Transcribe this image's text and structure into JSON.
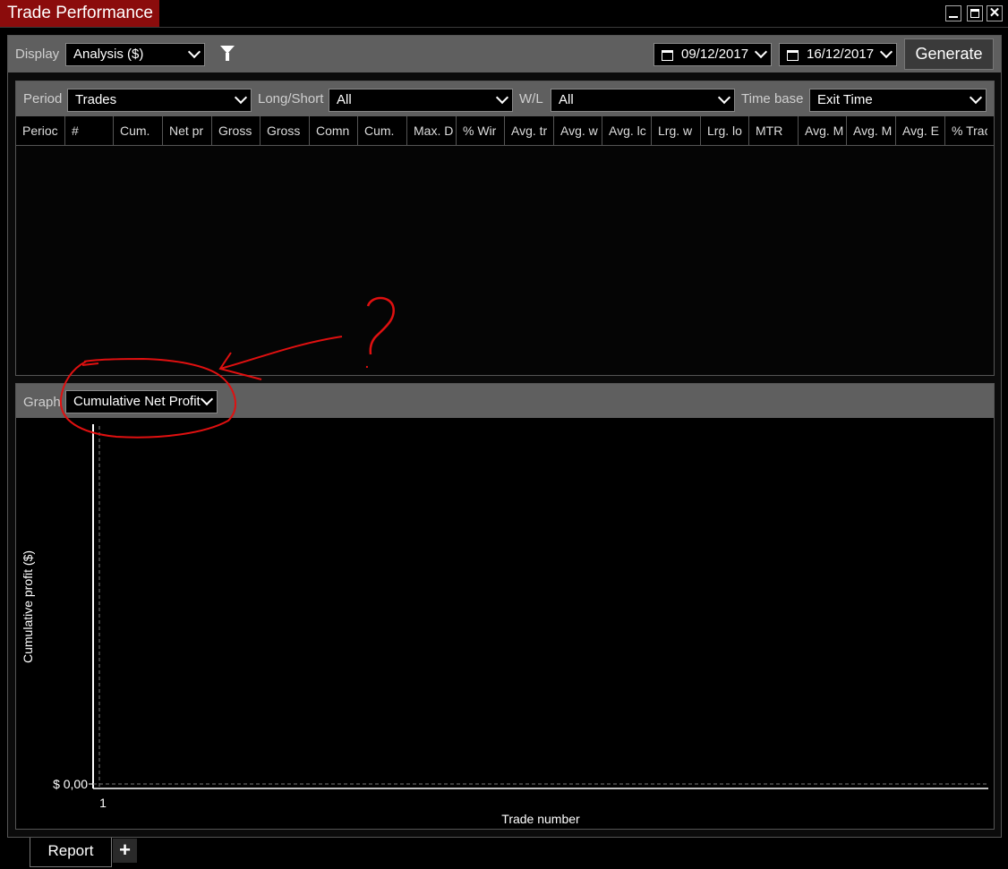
{
  "window": {
    "title": "Trade Performance"
  },
  "toolbar": {
    "display_label": "Display",
    "display_value": "Analysis ($)",
    "date_from": "09/12/2017",
    "date_to": "16/12/2017",
    "generate_label": "Generate"
  },
  "filters": {
    "period_label": "Period",
    "period_value": "Trades",
    "longshort_label": "Long/Short",
    "longshort_value": "All",
    "wl_label": "W/L",
    "wl_value": "All",
    "timebase_label": "Time base",
    "timebase_value": "Exit Time"
  },
  "table": {
    "columns": [
      "Perioc",
      "#",
      "Cum.",
      "Net pr",
      "Gross",
      "Gross",
      "Comn",
      "Cum.",
      "Max. D",
      "% Wir",
      "Avg. tr",
      "Avg. w",
      "Avg. lc",
      "Lrg. w",
      "Lrg. lo",
      "MTR",
      "Avg. M",
      "Avg. M",
      "Avg. E",
      "% Trac"
    ]
  },
  "graph": {
    "label": "Graph",
    "selected": "Cumulative Net Profit"
  },
  "chart_data": {
    "type": "line",
    "title": "",
    "xlabel": "Trade number",
    "ylabel": "Cumulative profit ($)",
    "x_ticks": [
      "1"
    ],
    "y_ticks": [
      "$ 0,00"
    ],
    "series": []
  },
  "annotation": {
    "text": "?"
  },
  "tabs": {
    "report_label": "Report",
    "add_label": "+"
  },
  "colors": {
    "title_bg": "#8b0c0c",
    "annotation": "#e01010",
    "bar_bg": "#5f5f5f"
  }
}
